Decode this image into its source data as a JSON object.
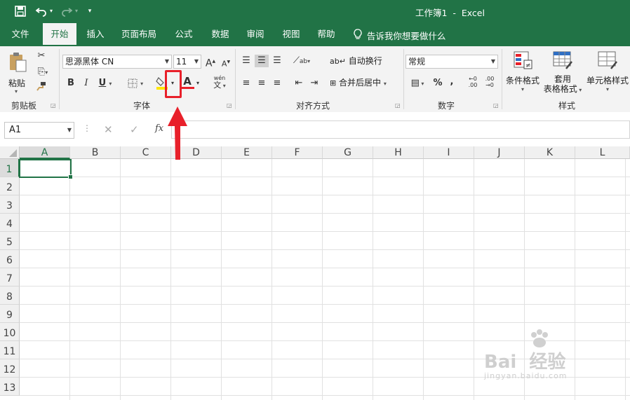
{
  "window": {
    "title": "工作簿1  -  Excel"
  },
  "qat": {
    "redo_arrow": "▾",
    "customize": "▾"
  },
  "ribbon_tabs": [
    "文件",
    "开始",
    "插入",
    "页面布局",
    "公式",
    "数据",
    "审阅",
    "视图",
    "帮助"
  ],
  "active_tab_index": 1,
  "tell_me": {
    "text": "告诉我你想要做什么"
  },
  "clipboard": {
    "paste_label": "粘贴",
    "group_label": "剪贴板"
  },
  "font": {
    "font_name": "思源黑体 CN",
    "font_size": "11",
    "bold": "B",
    "italic": "I",
    "underline": "U",
    "grow": "A",
    "shrink": "A",
    "font_color_letter": "A",
    "phonetic_top": "wén",
    "phonetic_bottom": "文",
    "group_label": "字体"
  },
  "alignment": {
    "wrap_text": "自动换行",
    "merge_center": "合并后居中",
    "group_label": "对齐方式"
  },
  "number": {
    "format": "常规",
    "percent": "%",
    "comma": ",",
    "group_label": "数字",
    "inc_decimal": ".00",
    "dec_decimal": ".00"
  },
  "styles": {
    "conditional": "条件格式",
    "table_format_1": "套用",
    "table_format_2": "表格格式",
    "cell_styles": "单元格样式",
    "group_label": "样式"
  },
  "formula_bar": {
    "name_box": "A1",
    "fx": "fx",
    "formula": ""
  },
  "columns": [
    "A",
    "B",
    "C",
    "D",
    "E",
    "F",
    "G",
    "H",
    "I",
    "J",
    "K",
    "L"
  ],
  "rows": [
    "1",
    "2",
    "3",
    "4",
    "5",
    "6",
    "7",
    "8",
    "9",
    "10",
    "11",
    "12",
    "13"
  ],
  "selected_cell": "A1",
  "watermark": {
    "brand": "Bai  经验",
    "url": "jingyan.baidu.com"
  },
  "colors": {
    "excel_green": "#217346",
    "highlight_red": "#e8202a",
    "fill_yellow": "#ffe600",
    "font_red": "#e8202a"
  }
}
